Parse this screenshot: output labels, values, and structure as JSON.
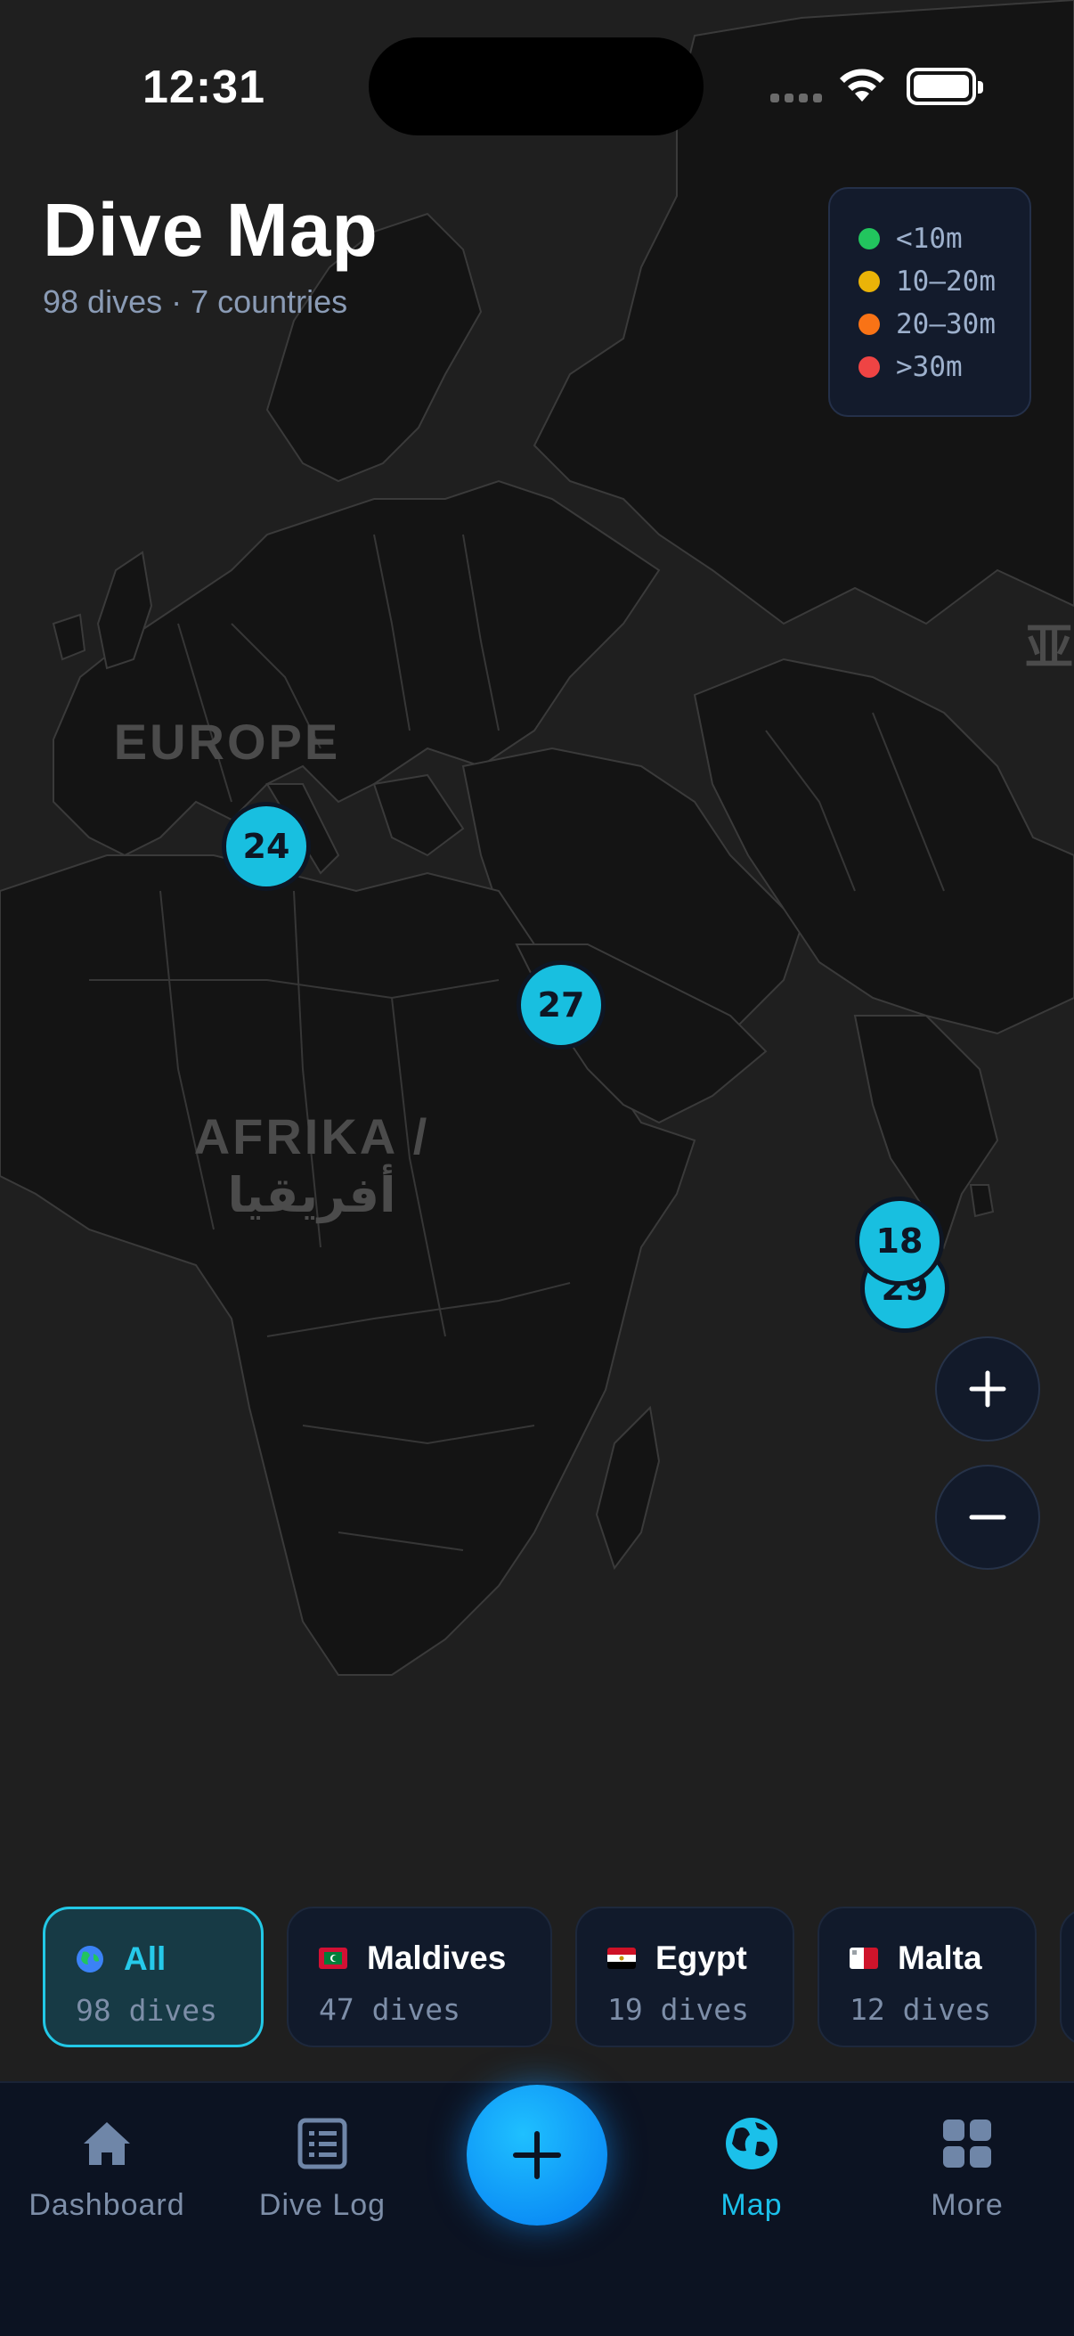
{
  "status_bar": {
    "time": "12:31"
  },
  "header": {
    "title": "Dive Map",
    "subtitle": "98 dives · 7 countries"
  },
  "map_labels": {
    "europe": "EUROPE",
    "africa_line1": "AFRIKA /",
    "africa_line2": "أفريقيا",
    "asia_partial": "亚"
  },
  "legend": [
    {
      "label": "<10m",
      "color": "#22c55e"
    },
    {
      "label": "10–20m",
      "color": "#eab308"
    },
    {
      "label": "20–30m",
      "color": "#f97316"
    },
    {
      "label": ">30m",
      "color": "#ef4444"
    }
  ],
  "clusters": [
    {
      "count": "24"
    },
    {
      "count": "27"
    },
    {
      "count": "29"
    },
    {
      "count": "18"
    }
  ],
  "filters": [
    {
      "name": "All",
      "count": "98 dives",
      "flag": "globe-icon",
      "active": true
    },
    {
      "name": "Maldives",
      "count": "47 dives",
      "flag": "maldives-flag"
    },
    {
      "name": "Egypt",
      "count": "19 dives",
      "flag": "egypt-flag"
    },
    {
      "name": "Malta",
      "count": "12 dives",
      "flag": "malta-flag"
    }
  ],
  "tabs": [
    {
      "label": "Dashboard",
      "icon": "home-icon"
    },
    {
      "label": "Dive Log",
      "icon": "list-icon"
    },
    {
      "label": "Map",
      "icon": "globe-icon",
      "active": true
    },
    {
      "label": "More",
      "icon": "grid-icon"
    }
  ],
  "colors": {
    "accent": "#1bc0ea",
    "cluster": "#18bfe0",
    "fab": "#0a8af5",
    "tab_bg": "#0c1322"
  }
}
